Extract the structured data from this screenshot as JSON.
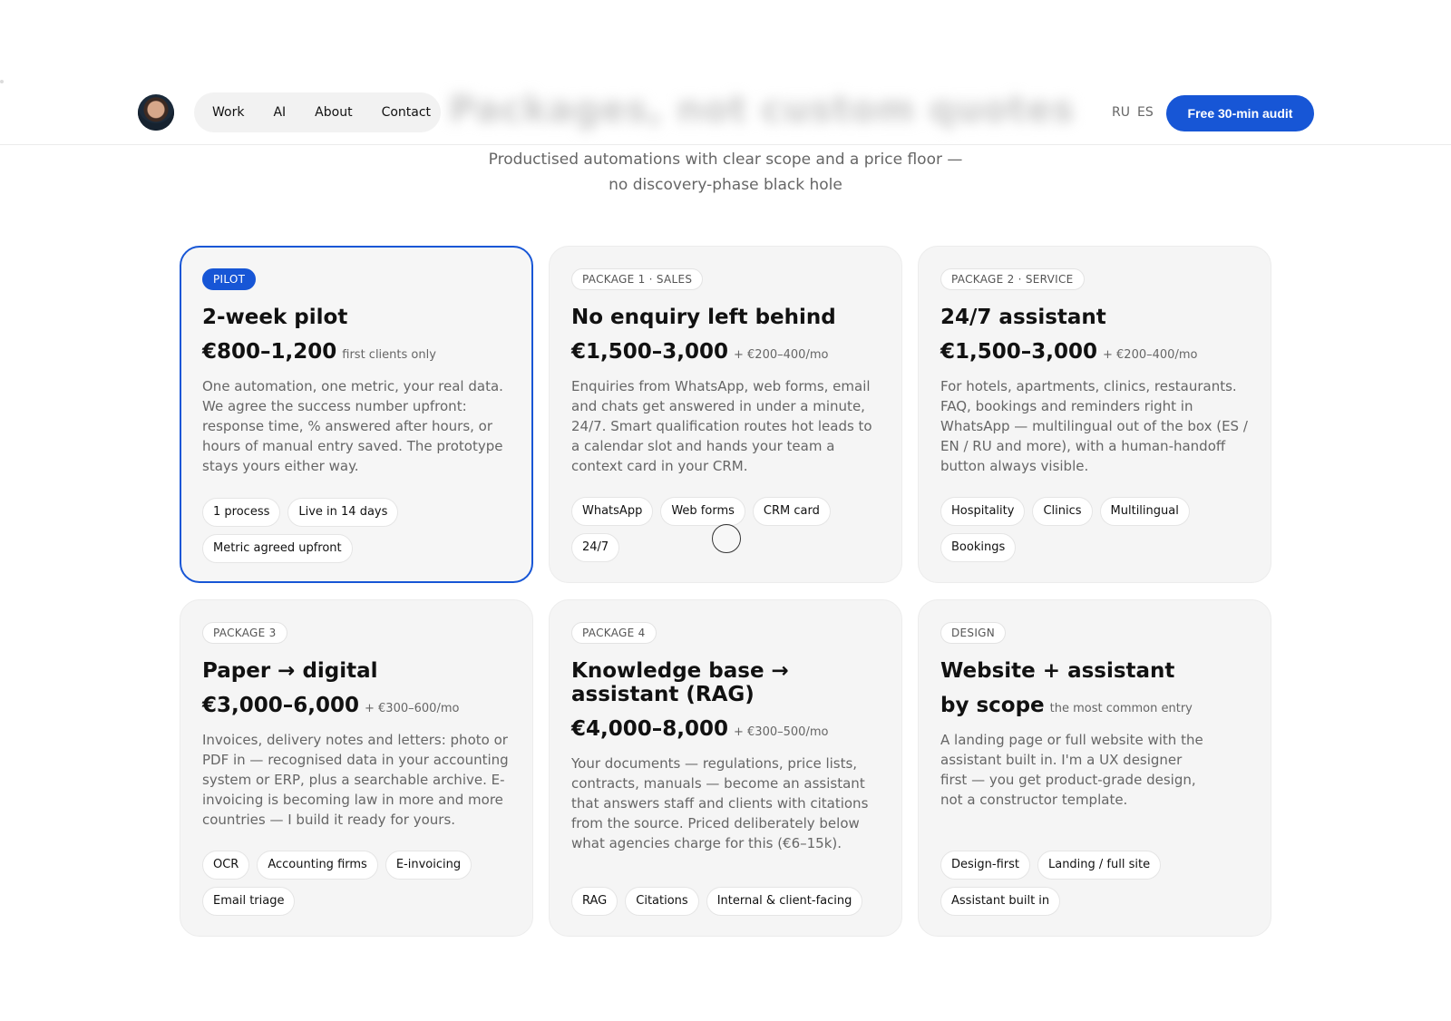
{
  "header": {
    "nav": [
      "Work",
      "AI",
      "About",
      "Contact"
    ],
    "ghost_title": "Packages, not custom quotes",
    "lang": [
      "RU",
      "ES"
    ],
    "cta_label": "Free 30-min audit"
  },
  "subtitle": {
    "line1": "Productised automations with clear scope and a price floor —",
    "line2": "no discovery-phase black hole"
  },
  "cards": [
    {
      "badge": "PILOT",
      "title": "2-week pilot",
      "price": "€800–1,200",
      "price_note": "first clients only",
      "desc": "One automation, one metric, your real data. We agree the success number upfront: response time, % answered after hours, or hours of manual entry saved. The prototype stays yours either way.",
      "chips": [
        "1 process",
        "Live in 14 days",
        "Metric agreed upfront"
      ]
    },
    {
      "badge": "PACKAGE 1 · SALES",
      "title": "No enquiry left behind",
      "price": "€1,500–3,000",
      "price_note": "+ €200–400/mo",
      "desc": "Enquiries from WhatsApp, web forms, email and chats get answered in under a minute, 24/7. Smart qualification routes hot leads to a calendar slot and hands your team a context card in your CRM.",
      "chips": [
        "WhatsApp",
        "Web forms",
        "CRM card",
        "24/7"
      ]
    },
    {
      "badge": "PACKAGE 2 · SERVICE",
      "title": "24/7 assistant",
      "price": "€1,500–3,000",
      "price_note": "+ €200–400/mo",
      "desc": "For hotels, apartments, clinics, restaurants. FAQ, bookings and reminders right in WhatsApp — multilingual out of the box (ES / EN / RU and more), with a human-handoff button always visible.",
      "chips": [
        "Hospitality",
        "Clinics",
        "Multilingual",
        "Bookings"
      ]
    },
    {
      "badge": "PACKAGE 3",
      "title": "Paper → digital",
      "price": "€3,000–6,000",
      "price_note": "+ €300–600/mo",
      "desc": "Invoices, delivery notes and letters: photo or PDF in — recognised data in your accounting system or ERP, plus a searchable archive. E-invoicing is becoming law in more and more countries — I build it ready for yours.",
      "chips": [
        "OCR",
        "Accounting firms",
        "E-invoicing",
        "Email triage"
      ]
    },
    {
      "badge": "PACKAGE 4",
      "title": "Knowledge base → assistant (RAG)",
      "price": "€4,000–8,000",
      "price_note": "+ €300–500/mo",
      "desc": "Your documents — regulations, price lists, contracts, manuals — become an assistant that answers staff and clients with citations from the source. Priced deliberately below what agencies charge for this (€6–15k).",
      "chips": [
        "RAG",
        "Citations",
        "Internal & client-facing"
      ]
    },
    {
      "badge": "DESIGN",
      "title": "Website + assistant",
      "price": "by scope",
      "price_note": "the most common entry",
      "desc": "A landing page or full website with the assistant built in. I'm a UX designer first — you get product-grade design, not a constructor template.",
      "chips": [
        "Design-first",
        "Landing / full site",
        "Assistant built in"
      ]
    }
  ],
  "colors": {
    "accent": "#1756d6",
    "card_bg": "#f5f5f5",
    "muted_text": "#666666"
  }
}
